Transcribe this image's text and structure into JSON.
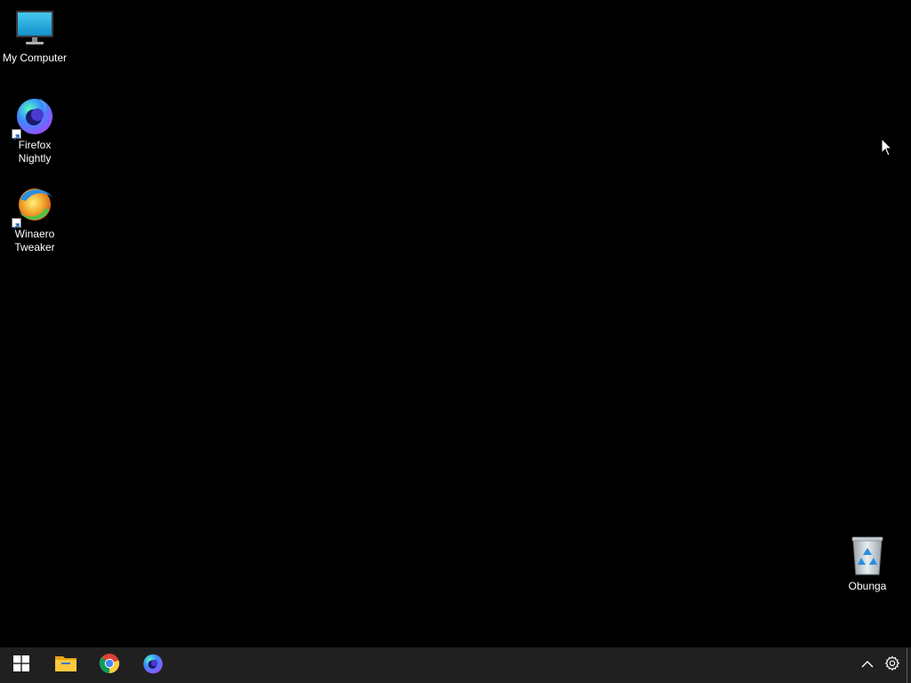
{
  "desktop": {
    "background": "#000000",
    "icons": [
      {
        "label": "My Computer",
        "icon": "monitor-icon"
      },
      {
        "label": "Firefox\nNightly",
        "icon": "firefox-nightly-icon"
      },
      {
        "label": "Winaero\nTweaker",
        "icon": "winaero-tweaker-icon"
      },
      {
        "label": "Obunga",
        "icon": "recycle-bin-icon"
      }
    ]
  },
  "taskbar": {
    "background": "#202020",
    "pinned": [
      {
        "name": "start-button",
        "icon": "windows-logo-icon"
      },
      {
        "name": "file-explorer",
        "icon": "folder-icon"
      },
      {
        "name": "google-chrome",
        "icon": "chrome-icon"
      },
      {
        "name": "firefox-nightly",
        "icon": "firefox-nightly-icon"
      }
    ],
    "tray": [
      {
        "icon": "chevron-up-icon"
      },
      {
        "icon": "gear-icon"
      }
    ]
  }
}
